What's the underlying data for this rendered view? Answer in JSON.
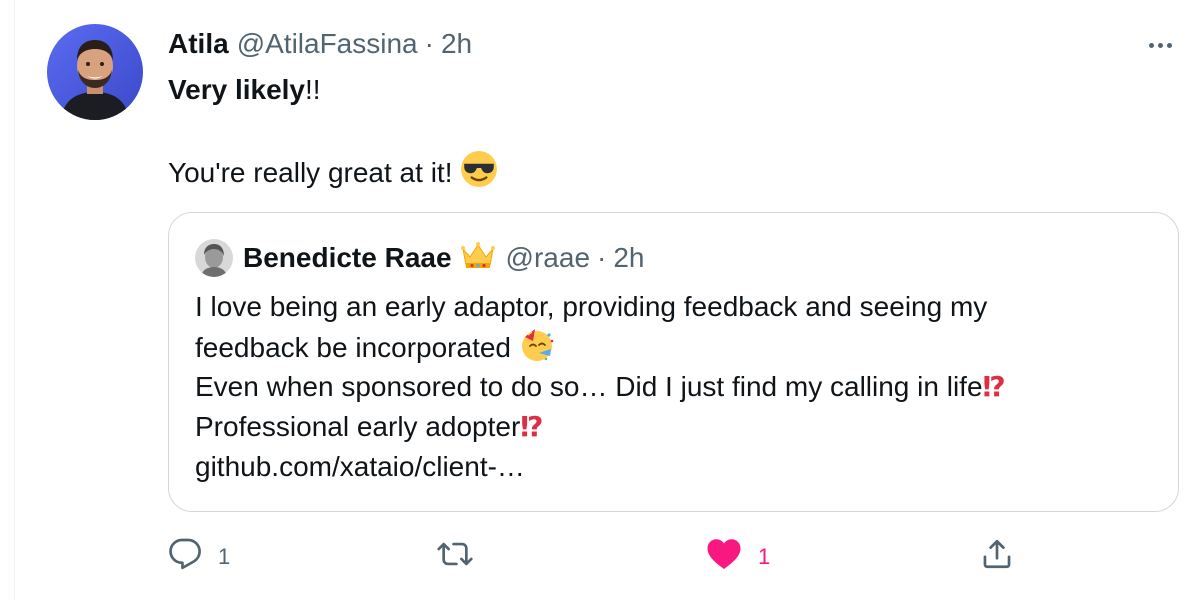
{
  "tweet": {
    "author_name": "Atila",
    "author_handle": "@AtilaFassina",
    "separator": "·",
    "time": "2h",
    "text_bold": "Very likely",
    "text_after_bold": "!!",
    "text_line2": "You're really great at it!",
    "text_line2_emoji": "smiling-face-with-sunglasses-emoji"
  },
  "quote": {
    "author_name": "Benedicte Raae",
    "name_emoji": "crown-emoji",
    "author_handle": "@raae",
    "separator": "·",
    "time": "2h",
    "lines": [
      "I love being an early adaptor, providing feedback and seeing my",
      "feedback be incorporated",
      "Even when sponsored to do so… Did I just find my calling in life",
      "Professional early adopter",
      "github.com/xataio/client-…"
    ]
  },
  "actions": {
    "reply_count": "1",
    "retweet_count": "",
    "like_count": "1",
    "reply_icon": "reply-icon",
    "retweet_icon": "retweet-icon",
    "like_icon": "heart-icon",
    "share_icon": "share-icon"
  },
  "colors": {
    "text": "#0f1419",
    "secondary": "#536471",
    "like": "#f91880",
    "border": "#cfd9de"
  }
}
